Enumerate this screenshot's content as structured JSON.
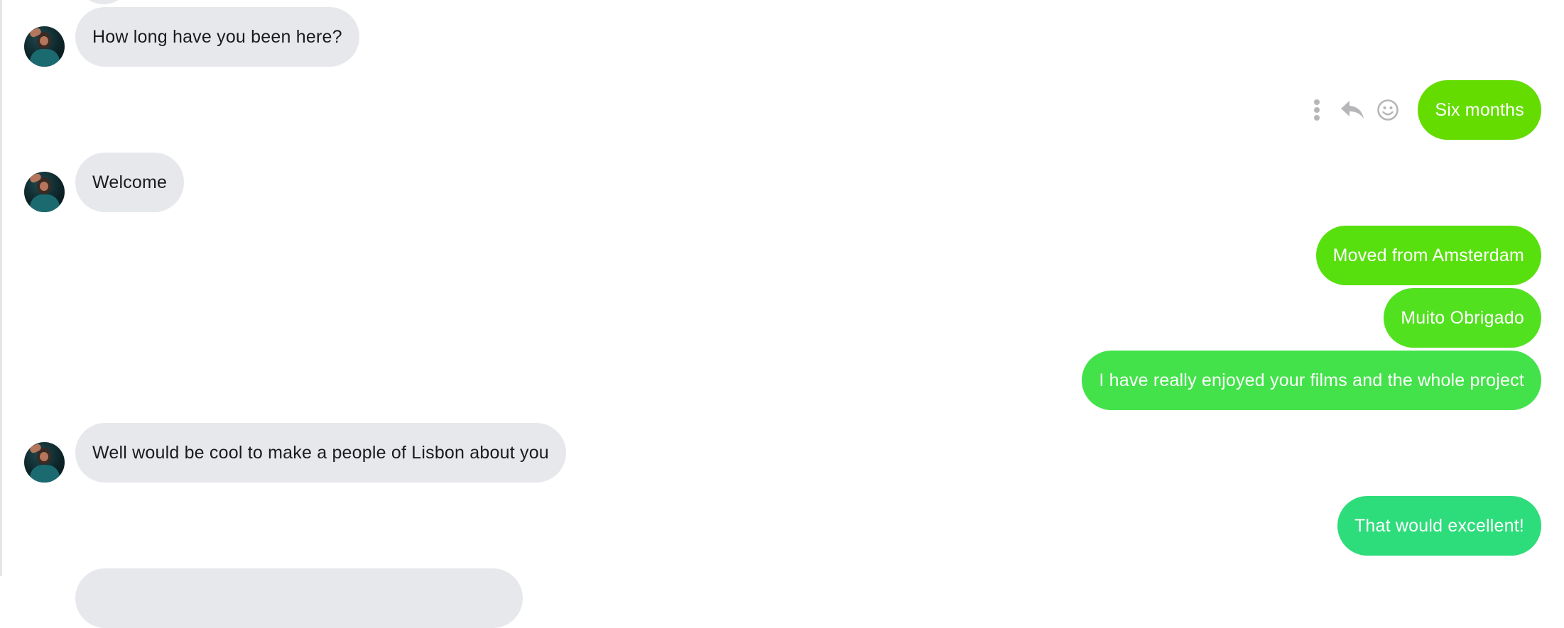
{
  "messages": [
    {
      "id": "m1",
      "direction": "incoming",
      "text": "How long have you been here?"
    },
    {
      "id": "m2",
      "direction": "outgoing",
      "text": "Six months",
      "color": "#64dc00"
    },
    {
      "id": "m3",
      "direction": "incoming",
      "text": "Welcome"
    },
    {
      "id": "m4",
      "direction": "outgoing",
      "text": "Moved from Amsterdam",
      "color": "#58e00e"
    },
    {
      "id": "m5",
      "direction": "outgoing",
      "text": "Muito Obrigado",
      "color": "#52e11f"
    },
    {
      "id": "m6",
      "direction": "outgoing",
      "text": "I have really enjoyed your films and the whole project",
      "color": "#43e24a"
    },
    {
      "id": "m7",
      "direction": "incoming",
      "text": "Well would be cool to make a people of Lisbon about you"
    },
    {
      "id": "m8",
      "direction": "outgoing",
      "text": "That would excellent!",
      "color": "#2ddc7a"
    }
  ],
  "message_actions": {
    "icons": [
      "more-vertical-icon",
      "reply-icon",
      "emoji-icon"
    ]
  },
  "colors": {
    "incoming_bubble": "#e7e8eb",
    "incoming_text": "#1b1b1f",
    "outgoing_text": "#ffffff",
    "action_icon": "#b6b6b8"
  }
}
